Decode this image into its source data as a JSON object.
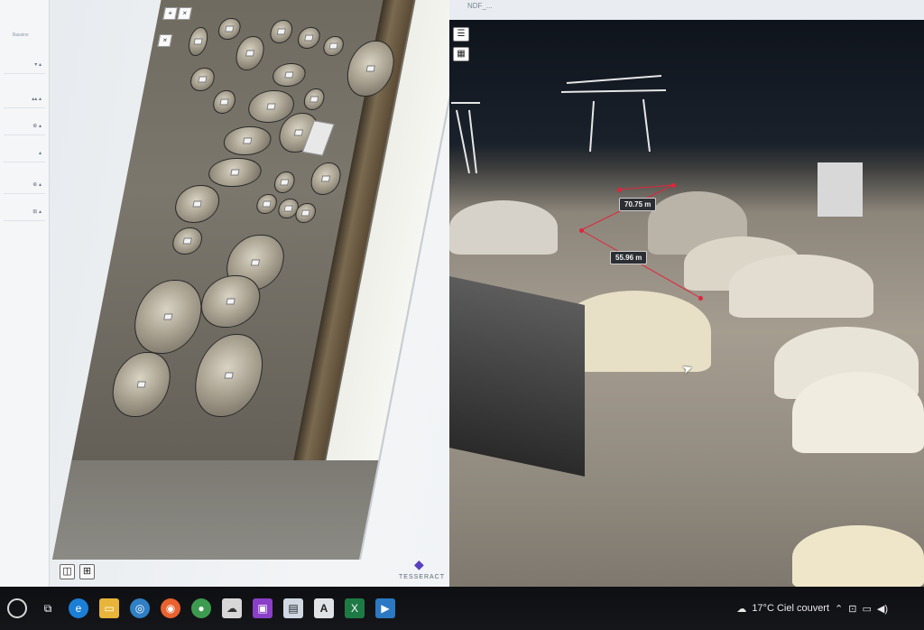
{
  "viewer": {
    "tab_title": "NDF_...",
    "measurements": [
      "70.75 m",
      "55.96 m"
    ],
    "menu_icon": "hamburger-icon",
    "layer_icon": "layers-icon"
  },
  "left_panel": {
    "label": "Bassins"
  },
  "brand": {
    "name": "TESSERACT"
  },
  "taskbar": {
    "weather": "17°C Ciel couvert",
    "weather_icon": "cloud-icon",
    "apps": [
      "search",
      "task-view",
      "edge",
      "file-explorer",
      "chrome",
      "firefox",
      "maps",
      "app",
      "app-purple",
      "notepad",
      "text-app",
      "excel",
      "media"
    ]
  },
  "colors": {
    "measure_line": "#e0253a",
    "brand": "#5a3fc0",
    "taskbar": "#111214"
  }
}
